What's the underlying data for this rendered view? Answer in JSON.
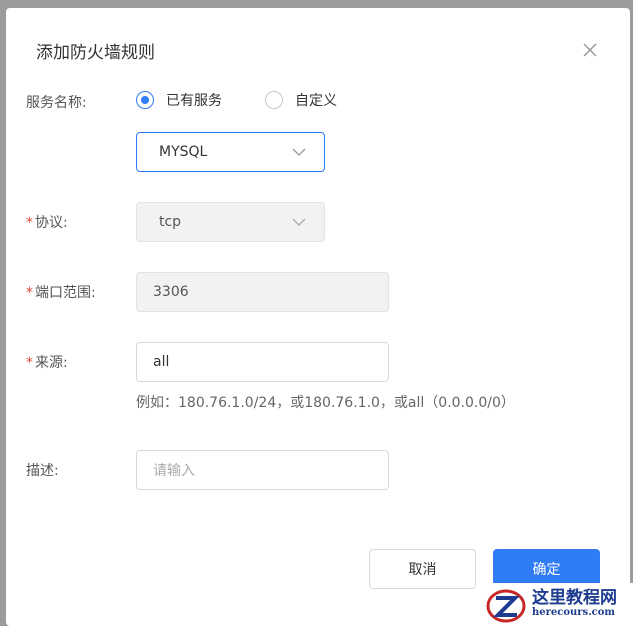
{
  "dialog": {
    "title": "添加防火墙规则",
    "close_icon": "close-icon"
  },
  "form": {
    "service": {
      "label": "服务名称:",
      "options": [
        {
          "label": "已有服务",
          "checked": true
        },
        {
          "label": "自定义",
          "checked": false
        }
      ],
      "selected_value": "MYSQL"
    },
    "protocol": {
      "label": "协议:",
      "required": "*",
      "value": "tcp"
    },
    "port_range": {
      "label": "端口范围:",
      "required": "*",
      "value": "3306"
    },
    "source": {
      "label": "来源:",
      "required": "*",
      "value": "all",
      "hint": "例如：180.76.1.0/24，或180.76.1.0，或all（0.0.0.0/0）"
    },
    "description": {
      "label": "描述:",
      "placeholder": "请输入"
    }
  },
  "buttons": {
    "cancel": "取消",
    "confirm": "确定"
  },
  "watermark": {
    "title": "这里教程网",
    "subtitle": "herecours.com"
  },
  "colors": {
    "accent": "#2f7cf6",
    "required": "#e64a3b"
  }
}
